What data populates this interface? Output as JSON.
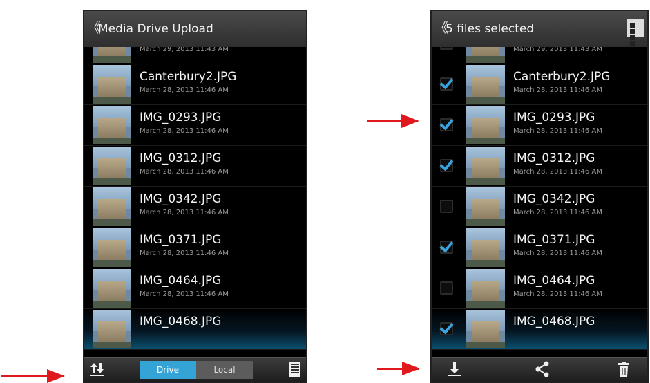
{
  "left_screen": {
    "title": "Media Drive Upload",
    "back_glyph": "《",
    "files": [
      {
        "name": "",
        "date": "March 29, 2013 11:43 AM"
      },
      {
        "name": "Canterbury2.JPG",
        "date": "March 28, 2013 11:46 AM"
      },
      {
        "name": "IMG_0293.JPG",
        "date": "March 28, 2013 11:46 AM"
      },
      {
        "name": "IMG_0312.JPG",
        "date": "March 28, 2013 11:46 AM"
      },
      {
        "name": "IMG_0342.JPG",
        "date": "March 28, 2013 11:46 AM"
      },
      {
        "name": "IMG_0371.JPG",
        "date": "March 28, 2013 11:46 AM"
      },
      {
        "name": "IMG_0464.JPG",
        "date": "March 28, 2013 11:46 AM"
      },
      {
        "name": "IMG_0468.JPG",
        "date": ""
      }
    ],
    "toolbar": {
      "sort_icon": "sort-arrows-icon",
      "drive_label": "Drive",
      "local_label": "Local",
      "list_icon": "list-view-icon"
    }
  },
  "right_screen": {
    "title": "5 files selected",
    "back_glyph": "《",
    "grid_icon": "grid-view-icon",
    "files": [
      {
        "name": "",
        "date": "March 29, 2013 11:43 AM",
        "checked": false
      },
      {
        "name": "Canterbury2.JPG",
        "date": "March 28, 2013 11:46 AM",
        "checked": true
      },
      {
        "name": "IMG_0293.JPG",
        "date": "March 28, 2013 11:46 AM",
        "checked": true
      },
      {
        "name": "IMG_0312.JPG",
        "date": "March 28, 2013 11:46 AM",
        "checked": true
      },
      {
        "name": "IMG_0342.JPG",
        "date": "March 28, 2013 11:46 AM",
        "checked": false
      },
      {
        "name": "IMG_0371.JPG",
        "date": "March 28, 2013 11:46 AM",
        "checked": true
      },
      {
        "name": "IMG_0464.JPG",
        "date": "March 28, 2013 11:46 AM",
        "checked": false
      },
      {
        "name": "IMG_0468.JPG",
        "date": "",
        "checked": true
      }
    ],
    "toolbar": {
      "download_icon": "download-icon",
      "share_icon": "share-icon",
      "delete_icon": "trash-icon"
    }
  },
  "colors": {
    "accent": "#34a4d6",
    "arrow": "#e0191e",
    "checkmark": "#39a3dd"
  }
}
